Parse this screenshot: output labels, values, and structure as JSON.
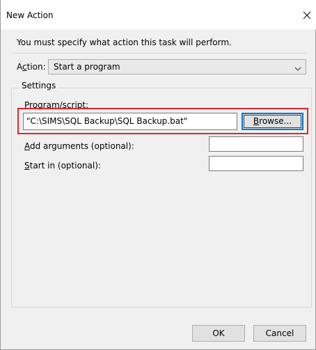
{
  "window": {
    "title": "New Action"
  },
  "instruction": "You must specify what action this task will perform.",
  "action": {
    "label_accel": "c",
    "label_pre": "A",
    "label_post": "tion:",
    "selected": "Start a program"
  },
  "settings": {
    "legend": "Settings",
    "program": {
      "label_accel": "P",
      "label_rest": "rogram/script:",
      "value": "\"C:\\SIMS\\SQL Backup\\SQL Backup.bat\"",
      "browse_accel": "B",
      "browse_rest": "rowse..."
    },
    "arguments": {
      "label_accel": "A",
      "label_rest": "dd arguments (optional):",
      "value": ""
    },
    "start_in": {
      "label_accel": "S",
      "label_rest": "tart in (optional):",
      "value": ""
    }
  },
  "buttons": {
    "ok": "OK",
    "cancel": "Cancel"
  },
  "colors": {
    "highlight": "#e0262c",
    "focus": "#0078d7"
  }
}
